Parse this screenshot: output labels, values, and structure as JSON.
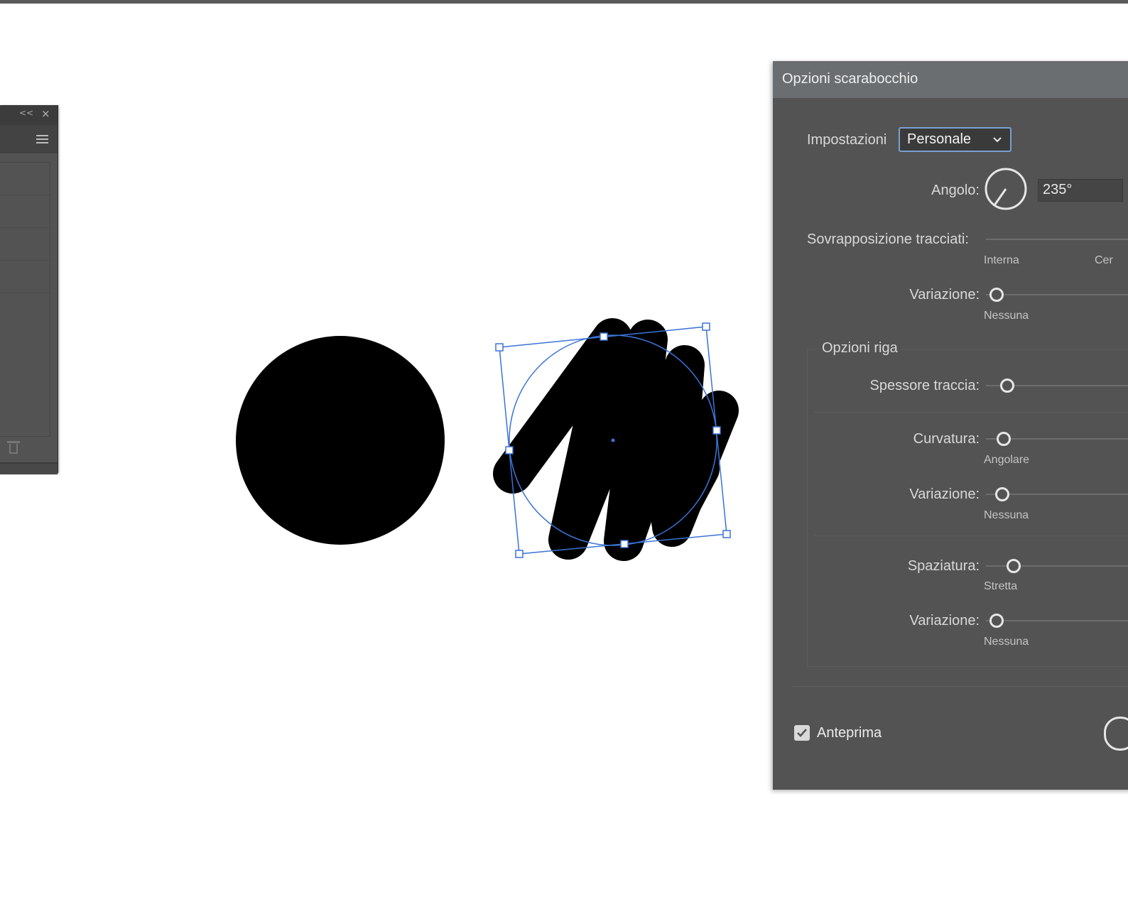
{
  "left_panel": {
    "collapse_label": "<<",
    "close_label": "×"
  },
  "dialog": {
    "title": "Opzioni scarabocchio",
    "settings": {
      "label": "Impostazioni",
      "value": "Personale"
    },
    "angle": {
      "label": "Angolo:",
      "value": "235°"
    },
    "path_overlap": {
      "label": "Sovrapposizione tracciati:",
      "min_label": "Interna",
      "mid_label": "Cer"
    },
    "path_overlap_variation": {
      "label": "Variazione:",
      "min_label": "Nessuna"
    },
    "line_options": {
      "title": "Opzioni riga",
      "stroke_width": {
        "label": "Spessore traccia:"
      },
      "curviness": {
        "label": "Curvatura:",
        "min_label": "Angolare"
      },
      "curviness_variation": {
        "label": "Variazione:",
        "min_label": "Nessuna"
      },
      "spacing": {
        "label": "Spaziatura:",
        "min_label": "Stretta"
      },
      "spacing_variation": {
        "label": "Variazione:",
        "min_label": "Nessuna"
      }
    },
    "preview": {
      "label": "Anteprima",
      "checked": true
    }
  },
  "colors": {
    "dialog_bg": "#535353",
    "title_bar": "#6b6e70",
    "selection_blue": "#3b73d6",
    "select_border": "#7a9fd2"
  }
}
